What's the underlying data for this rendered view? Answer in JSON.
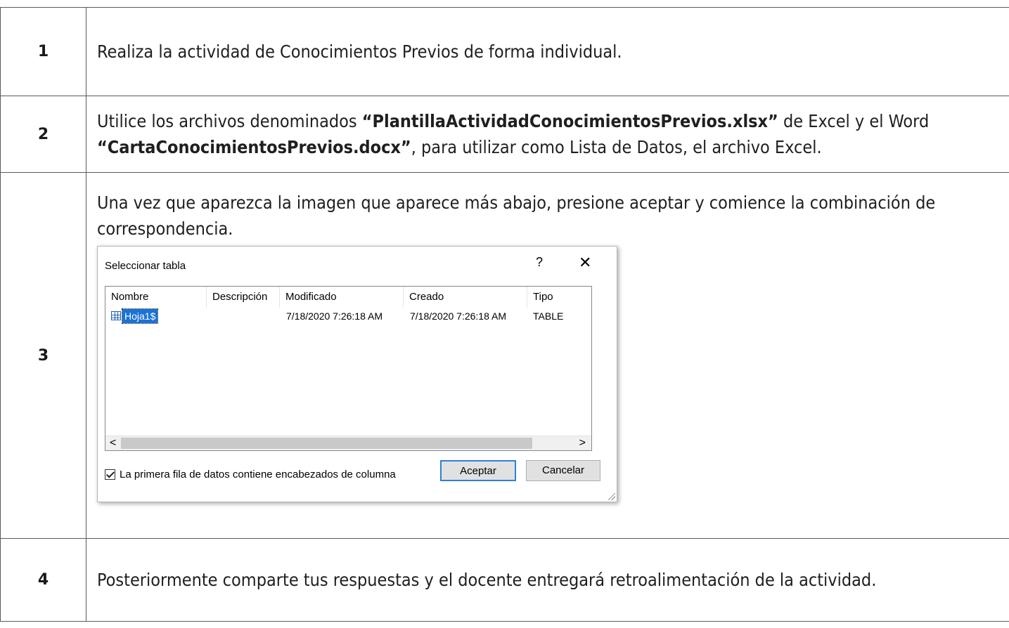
{
  "rows": [
    {
      "num": "1",
      "text": "Realiza la actividad de Conocimientos Previos de forma individual."
    },
    {
      "num": "2",
      "t1": "Utilice los archivos denominados ",
      "b1": "“PlantillaActividadConocimientosPrevios.xlsx”",
      "t2": " de Excel y el Word ",
      "b2": "“CartaConocimientosPrevios.docx”",
      "t3": ", para utilizar como Lista de Datos, el archivo Excel."
    },
    {
      "num": "3",
      "text": "Una vez que aparezca la imagen que aparece más abajo, presione aceptar y comience la combinación de correspondencia."
    },
    {
      "num": "4",
      "text": "Posteriormente comparte tus respuestas y el docente entregará retroalimentación de la actividad."
    }
  ],
  "dialog": {
    "title": "Seleccionar tabla",
    "help": "?",
    "close": "✕",
    "columns": [
      "Nombre",
      "Descripción",
      "Modificado",
      "Creado",
      "Tipo"
    ],
    "entry": {
      "name": "Hoja1$",
      "description": "",
      "modified": "7/18/2020 7:26:18 AM",
      "created": "7/18/2020 7:26:18 AM",
      "type": "TABLE"
    },
    "checkbox_label": "La primera fila de datos contiene encabezados de columna",
    "ok_label": "Aceptar",
    "cancel_label": "Cancelar",
    "scroll_left": "<",
    "scroll_right": ">"
  }
}
